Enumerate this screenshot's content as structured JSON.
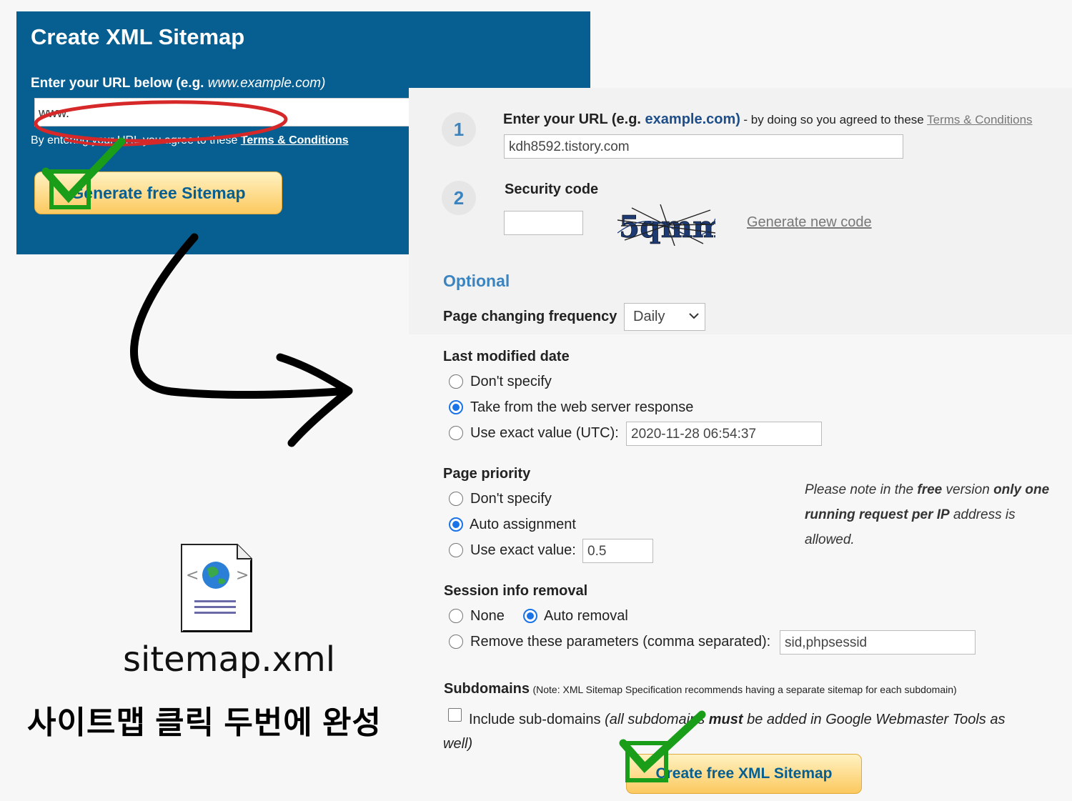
{
  "left_panel": {
    "title": "Create XML Sitemap",
    "prompt_main": "Enter your URL below (e.g. ",
    "prompt_example": "www.example.com)",
    "url_value": "www.",
    "agree_text": "By entering your URL you agree to these ",
    "agree_link": "Terms & Conditions",
    "button_label": "Generate free Sitemap"
  },
  "form": {
    "step1_number": "1",
    "step1_label": "Enter your URL (e.g. ",
    "step1_example": "example.com)",
    "step1_note": "- by doing so you agreed to these ",
    "step1_link": "Terms & Conditions",
    "url_value": "kdh8592.tistory.com",
    "step2_number": "2",
    "step2_label": "Security code",
    "security_input": "",
    "captcha_text": "5qmmx",
    "generate_code_link": "Generate new code",
    "optional_heading": "Optional",
    "frequency_label": "Page changing frequency",
    "frequency_value": "Daily",
    "last_modified": {
      "label": "Last modified date",
      "options": [
        "Don't specify",
        "Take from the web server response",
        "Use exact value (UTC):"
      ],
      "selected_index": 1,
      "exact_value": "2020-11-28 06:54:37"
    },
    "priority": {
      "label": "Page priority",
      "options": [
        "Don't specify",
        "Auto assignment",
        "Use exact value:"
      ],
      "selected_index": 1,
      "exact_value": "0.5"
    },
    "note_parts": [
      "Please note in the ",
      "free",
      " version ",
      "only one running request per IP",
      " address is allowed."
    ],
    "session": {
      "label": "Session info removal",
      "options": [
        "None",
        "Auto removal",
        "Remove these parameters (comma separated):"
      ],
      "selected_index": 1,
      "params_value": "sid,phpsessid"
    },
    "subdomains": {
      "label": "Subdomains",
      "note": "(Note: XML Sitemap Specification recommends having a separate sitemap for each subdomain)",
      "checkbox_label": "Include sub-domains",
      "italic_a": "(all subdomains ",
      "italic_bold": "must",
      "italic_b": " be added in Google Webmaster Tools as well)",
      "checked": false
    },
    "create_button": "Create free XML Sitemap"
  },
  "file": {
    "name": "sitemap.xml"
  },
  "caption": "사이트맵 클릭 두번에 완성",
  "colors": {
    "panel_blue": "#065f90",
    "accent_blue": "#3b84bf",
    "button_yellow": "#fcc95f",
    "annotation_red": "#d62828",
    "check_green": "#1a9e1a"
  }
}
